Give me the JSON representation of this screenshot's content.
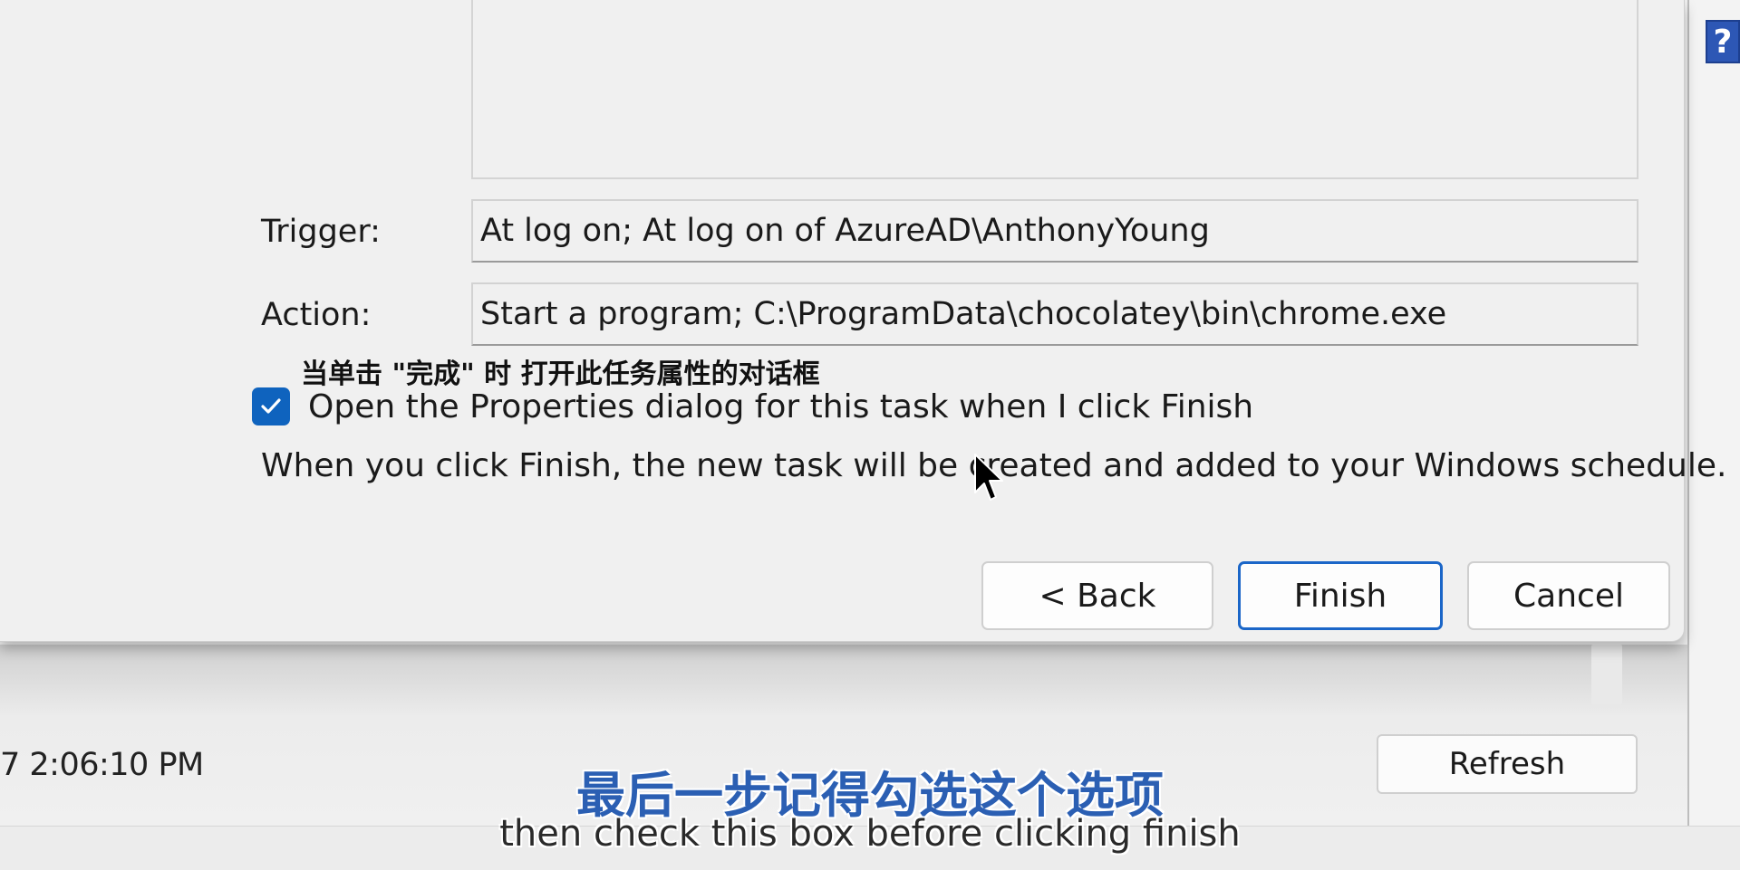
{
  "dialog": {
    "trigger_label": "Trigger:",
    "trigger_value": "At log on; At log on of AzureAD\\AnthonyYoung",
    "action_label": "Action:",
    "action_value": "Start a program; C:\\ProgramData\\chocolatey\\bin\\chrome.exe",
    "annotation_cn": "当单击 \"完成\" 时  打开此任务属性的对话框",
    "checkbox_label": "Open the Properties dialog for this task when I click Finish",
    "checkbox_checked": true,
    "info_text": "When you click Finish, the new task will be created and added to your Windows schedule.",
    "buttons": {
      "back": "< Back",
      "finish": "Finish",
      "cancel": "Cancel"
    }
  },
  "background_window": {
    "timestamp": "7 2:06:10 PM",
    "refresh_label": "Refresh",
    "help_glyph": "?"
  },
  "subtitles": {
    "cn": "最后一步记得勾选这个选项",
    "en": "then check this box before clicking finish"
  },
  "colors": {
    "checkbox_accent": "#0f63be",
    "primary_border": "#1b66c8",
    "subtitle_cn": "#2b5fb3",
    "help_icon": "#2d57b5"
  }
}
